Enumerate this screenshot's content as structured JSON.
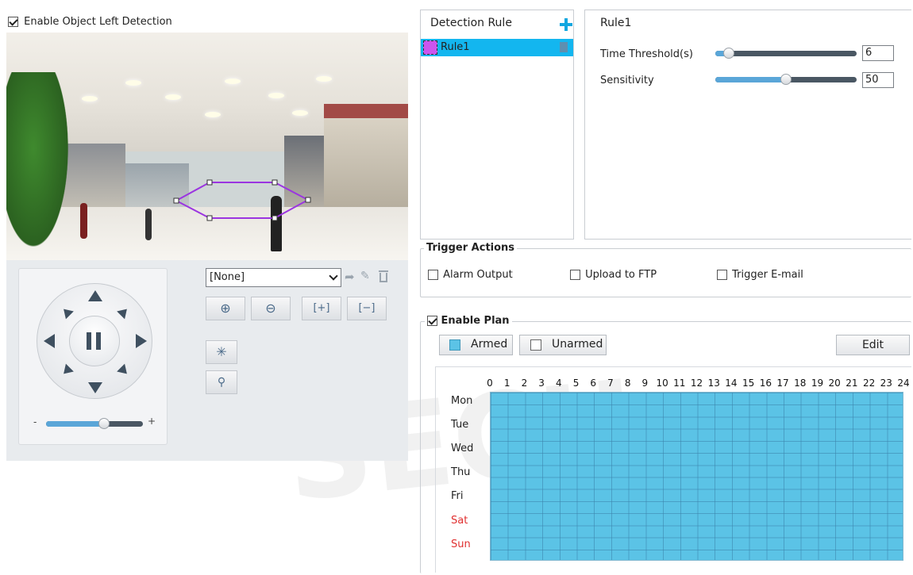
{
  "header": {
    "enable_label": "Enable Object Left Detection",
    "enabled": true
  },
  "preset": {
    "selected": "[None]"
  },
  "detection_rule": {
    "header": "Detection Rule",
    "rules": [
      {
        "label": "Rule1",
        "color": "#cc55ee"
      }
    ]
  },
  "rule_settings": {
    "title": "Rule1",
    "time_threshold": {
      "label": "Time Threshold(s)",
      "value": "6"
    },
    "sensitivity": {
      "label": "Sensitivity",
      "value": "50"
    }
  },
  "trigger_actions": {
    "title": "Trigger Actions",
    "alarm_output": "Alarm Output",
    "upload_ftp": "Upload to FTP",
    "trigger_email": "Trigger E-mail"
  },
  "plan": {
    "title": "Enable Plan",
    "enabled": true,
    "armed_label": "Armed",
    "unarmed_label": "Unarmed",
    "edit_label": "Edit",
    "armed_color": "#5bc3e6",
    "hours": [
      "0",
      "1",
      "2",
      "3",
      "4",
      "5",
      "6",
      "7",
      "8",
      "9",
      "10",
      "11",
      "12",
      "13",
      "14",
      "15",
      "16",
      "17",
      "18",
      "19",
      "20",
      "21",
      "22",
      "23",
      "24"
    ],
    "days": [
      "Mon",
      "Tue",
      "Wed",
      "Thu",
      "Fri",
      "Sat",
      "Sun"
    ]
  },
  "colors": {
    "accent": "#13a7e0",
    "weekend": "#e03030",
    "selected_row": "#13b6ef"
  }
}
